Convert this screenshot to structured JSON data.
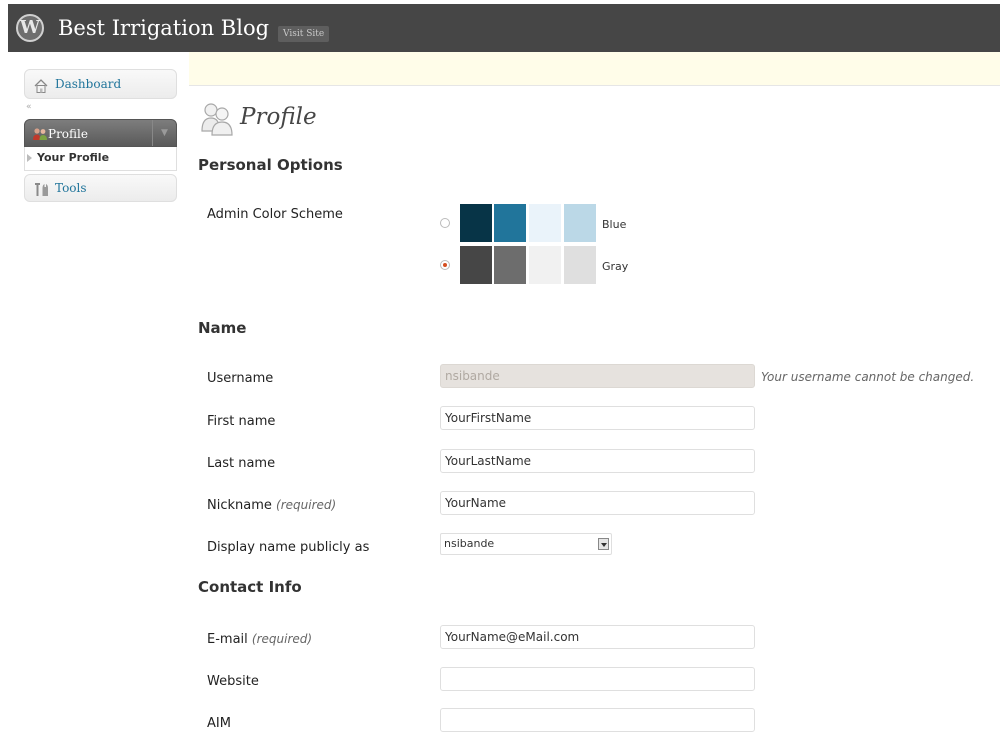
{
  "header": {
    "logo_glyph": "W",
    "site_title": "Best Irrigation Blog",
    "visit_site": "Visit Site"
  },
  "menu": {
    "dashboard": "Dashboard",
    "profile": "Profile",
    "your_profile": "Your Profile",
    "tools": "Tools",
    "collapse_glyph": "«",
    "toggle_glyph": "▼"
  },
  "page": {
    "title": "Profile"
  },
  "personal_options": {
    "heading": "Personal Options",
    "color_scheme_label": "Admin Color Scheme",
    "schemes": [
      {
        "name": "Blue",
        "selected": false,
        "colors": [
          "#073447",
          "#21759b",
          "#eaf3fa",
          "#bbd8e7"
        ]
      },
      {
        "name": "Gray",
        "selected": true,
        "colors": [
          "#464646",
          "#6d6d6d",
          "#f1f1f1",
          "#dfdfdf"
        ]
      }
    ]
  },
  "name_section": {
    "heading": "Name",
    "username_label": "Username",
    "username_value": "nsibande",
    "username_note": "Your username cannot be changed.",
    "first_name_label": "First name",
    "first_name_value": "YourFirstName",
    "last_name_label": "Last name",
    "last_name_value": "YourLastName",
    "nickname_label": "Nickname",
    "nickname_required": "(required)",
    "nickname_value": "YourName",
    "display_name_label": "Display name publicly as",
    "display_name_value": "nsibande"
  },
  "contact": {
    "heading": "Contact Info",
    "email_label": "E-mail",
    "email_required": "(required)",
    "email_value": "YourName@eMail.com",
    "website_label": "Website",
    "website_value": "",
    "aim_label": "AIM",
    "aim_value": ""
  }
}
